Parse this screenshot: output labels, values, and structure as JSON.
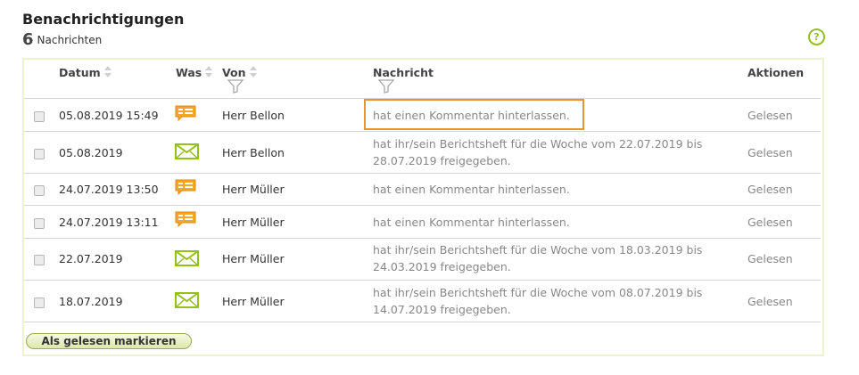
{
  "header": {
    "title": "Benachrichtigungen",
    "count": "6",
    "count_label": "Nachrichten",
    "help_glyph": "?"
  },
  "columns": {
    "datum": "Datum",
    "was": "Was",
    "von": "Von",
    "nachricht": "Nachricht",
    "aktionen": "Aktionen"
  },
  "rows": [
    {
      "date": "05.08.2019 15:49",
      "type": "comment-icon",
      "from": "Herr Bellon",
      "message_1": "hat einen Kommentar hinterlassen.",
      "message_2": "",
      "action": "Gelesen"
    },
    {
      "date": "05.08.2019",
      "type": "envelope-icon",
      "from": "Herr Bellon",
      "message_1": "hat ihr/sein Berichtsheft für die Woche vom 22.07.2019 bis",
      "message_2": "28.07.2019 freigegeben.",
      "action": "Gelesen"
    },
    {
      "date": "24.07.2019 13:50",
      "type": "comment-icon",
      "from": "Herr Müller",
      "message_1": "hat einen Kommentar hinterlassen.",
      "message_2": "",
      "action": "Gelesen"
    },
    {
      "date": "24.07.2019 13:11",
      "type": "comment-icon",
      "from": "Herr Müller",
      "message_1": "hat einen Kommentar hinterlassen.",
      "message_2": "",
      "action": "Gelesen"
    },
    {
      "date": "22.07.2019",
      "type": "envelope-icon",
      "from": "Herr Müller",
      "message_1": "hat ihr/sein Berichtsheft für die Woche vom 18.03.2019 bis",
      "message_2": "24.03.2019 freigegeben.",
      "action": "Gelesen"
    },
    {
      "date": "18.07.2019",
      "type": "envelope-icon",
      "from": "Herr Müller",
      "message_1": "hat ihr/sein Berichtsheft für die Woche vom 08.07.2019 bis",
      "message_2": "14.07.2019 freigegeben.",
      "action": "Gelesen"
    }
  ],
  "footer": {
    "mark_read_label": "Als gelesen markieren"
  },
  "colors": {
    "accent_green": "#95bf1b",
    "comment_orange": "#f5a623",
    "highlight_orange": "#f0922a"
  }
}
